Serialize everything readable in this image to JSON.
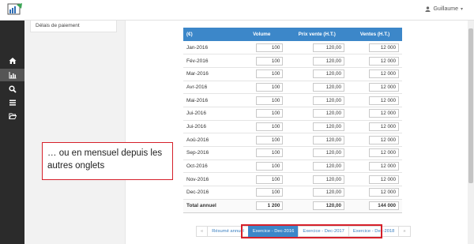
{
  "header": {
    "user_name": "Guillaume",
    "user_caret": "▾"
  },
  "sidebar": {
    "items": [
      {
        "icon": "home-icon",
        "active": false
      },
      {
        "icon": "bar-chart-icon",
        "active": true
      },
      {
        "icon": "search-icon",
        "active": false
      },
      {
        "icon": "list-icon",
        "active": false
      },
      {
        "icon": "folder-open-icon",
        "active": false
      }
    ]
  },
  "left_panel": {
    "label": "Délais de paiement"
  },
  "table": {
    "headers": [
      "(€)",
      "Volume",
      "Prix vente (H.T.)",
      "Ventes (H.T.)"
    ],
    "rows": [
      {
        "month": "Jan-2016",
        "volume": "100",
        "price": "120,00",
        "sales": "12 000"
      },
      {
        "month": "Fév-2016",
        "volume": "100",
        "price": "120,00",
        "sales": "12 000"
      },
      {
        "month": "Mar-2016",
        "volume": "100",
        "price": "120,00",
        "sales": "12 000"
      },
      {
        "month": "Avr-2016",
        "volume": "100",
        "price": "120,00",
        "sales": "12 000"
      },
      {
        "month": "Mai-2016",
        "volume": "100",
        "price": "120,00",
        "sales": "12 000"
      },
      {
        "month": "Jui-2016",
        "volume": "100",
        "price": "120,00",
        "sales": "12 000"
      },
      {
        "month": "Jui-2016",
        "volume": "100",
        "price": "120,00",
        "sales": "12 000"
      },
      {
        "month": "Aoû-2016",
        "volume": "100",
        "price": "120,00",
        "sales": "12 000"
      },
      {
        "month": "Sep-2016",
        "volume": "100",
        "price": "120,00",
        "sales": "12 000"
      },
      {
        "month": "Oct-2016",
        "volume": "100",
        "price": "120,00",
        "sales": "12 000"
      },
      {
        "month": "Nov-2016",
        "volume": "100",
        "price": "120,00",
        "sales": "12 000"
      },
      {
        "month": "Dec-2016",
        "volume": "100",
        "price": "120,00",
        "sales": "12 000"
      }
    ],
    "total": {
      "label": "Total annuel",
      "volume": "1 200",
      "price": "120,00",
      "sales": "144 000"
    }
  },
  "pager": {
    "prev": "«",
    "summary": "Résumé annuel",
    "tabs": [
      "Exercice - Dec-2016",
      "Exercice - Dec-2017",
      "Exercice - Dec-2018"
    ],
    "active_index": 0,
    "next": "»"
  },
  "callout": {
    "text": "… ou en mensuel depuis les autres onglets"
  },
  "colors": {
    "accent": "#3c87c9",
    "highlight": "#d6202a",
    "sidebar": "#2b2b2b"
  }
}
